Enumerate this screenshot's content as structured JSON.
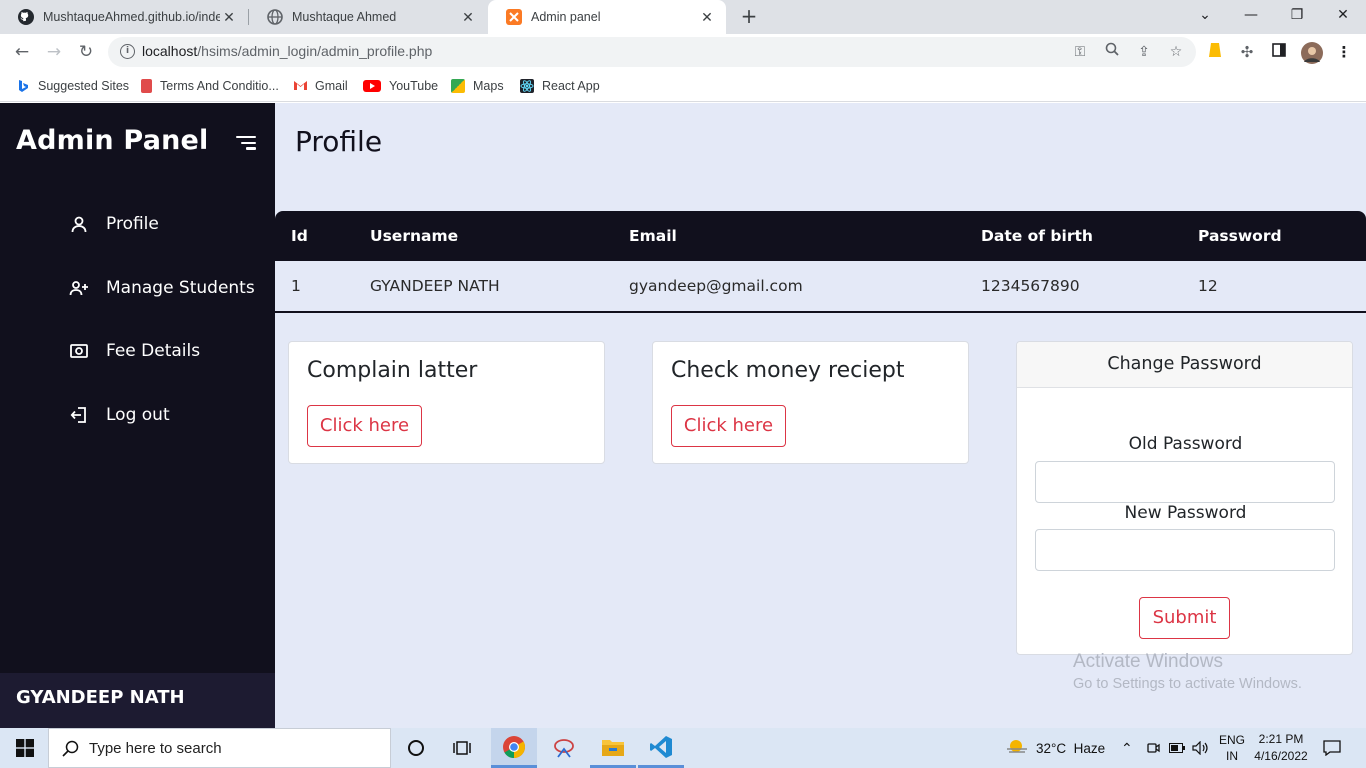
{
  "browser": {
    "tabs": [
      {
        "title": "MushtaqueAhmed.github.io/inde",
        "icon": "github-icon"
      },
      {
        "title": "Mushtaque Ahmed",
        "icon": "globe-icon"
      },
      {
        "title": "Admin panel",
        "icon": "xampp-icon"
      }
    ],
    "url_host": "localhost",
    "url_path": "/hsims/admin_login/admin_profile.php",
    "bookmarks": [
      {
        "label": "Suggested Sites"
      },
      {
        "label": "Terms And Conditio..."
      },
      {
        "label": "Gmail"
      },
      {
        "label": "YouTube"
      },
      {
        "label": "Maps"
      },
      {
        "label": "React App"
      }
    ]
  },
  "sidebar": {
    "brand": "Admin Panel",
    "items": [
      {
        "label": "Profile",
        "icon": "user-icon"
      },
      {
        "label": "Manage Students",
        "icon": "user-add-icon"
      },
      {
        "label": "Fee Details",
        "icon": "money-icon"
      },
      {
        "label": "Log out",
        "icon": "logout-icon"
      }
    ],
    "footer_name": "GYANDEEP NATH"
  },
  "main": {
    "title": "Profile",
    "table": {
      "headers": [
        "Id",
        "Username",
        "Email",
        "Date of birth",
        "Password"
      ],
      "row": [
        "1",
        "GYANDEEP NATH",
        "gyandeep@gmail.com",
        "1234567890",
        "12"
      ]
    },
    "cards": [
      {
        "title": "Complain latter",
        "button": "Click here"
      },
      {
        "title": "Check money reciept",
        "button": "Click here"
      }
    ],
    "change_password": {
      "title": "Change Password",
      "old_label": "Old Password",
      "new_label": "New Password",
      "submit": "Submit"
    },
    "watermark": {
      "line1": "Activate Windows",
      "line2": "Go to Settings to activate Windows."
    }
  },
  "taskbar": {
    "search_placeholder": "Type here to search",
    "weather": "32°C  Haze",
    "lang_top": "ENG",
    "lang_bottom": "IN",
    "time": "2:21 PM",
    "date": "4/16/2022"
  },
  "colors": {
    "sidebar_bg": "#11101d",
    "page_bg": "#e4e9f7",
    "danger": "#dc3545"
  }
}
